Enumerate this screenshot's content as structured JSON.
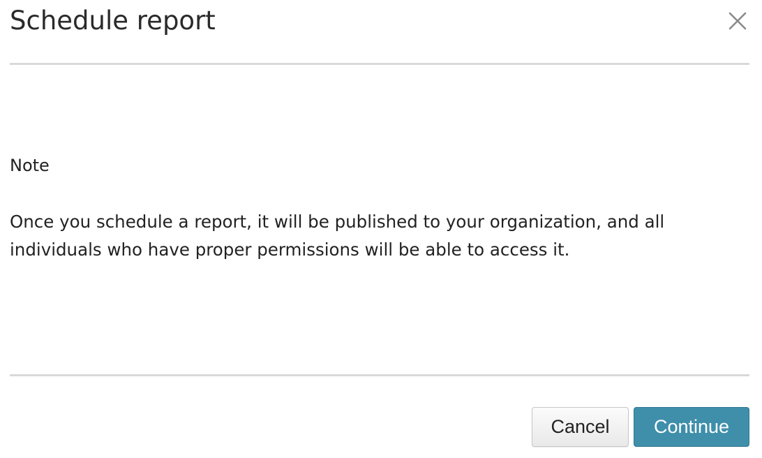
{
  "dialog": {
    "title": "Schedule report",
    "close_icon": "close-icon",
    "note_heading": "Note",
    "note_text": "Once you schedule a report, it will be published to your organization, and all individuals who have proper permissions will be able to access it.",
    "cancel_label": "Cancel",
    "continue_label": "Continue"
  },
  "colors": {
    "primary_button": "#3f8fab",
    "divider": "#d9d9d9",
    "text": "#222222"
  }
}
